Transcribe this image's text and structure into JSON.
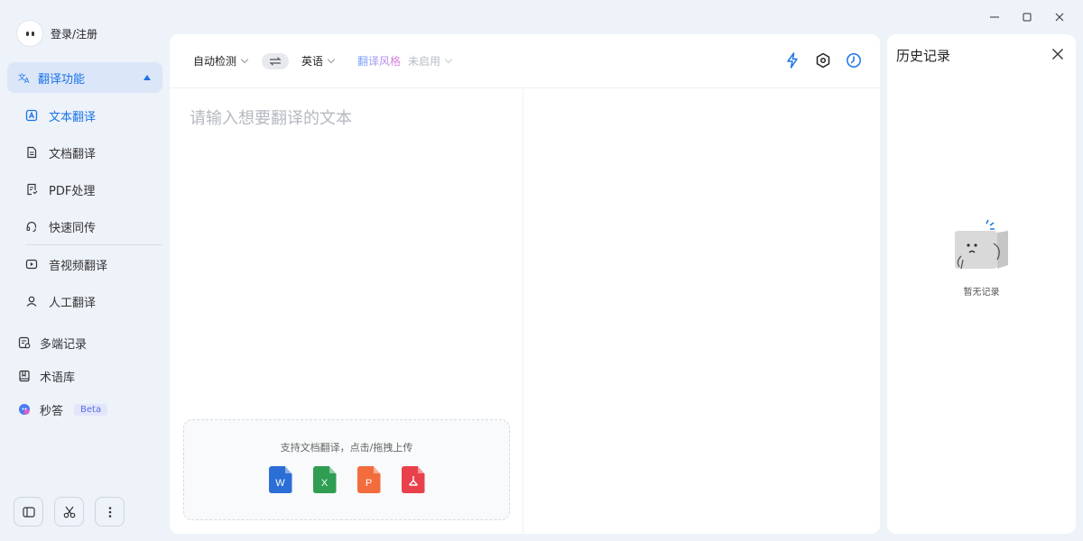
{
  "user": {
    "label": "登录/注册"
  },
  "nav": {
    "group_label": "翻译功能",
    "sub_items": [
      {
        "label": "文本翻译",
        "icon": "text-translate-icon",
        "active": true
      },
      {
        "label": "文档翻译",
        "icon": "document-icon",
        "active": false
      },
      {
        "label": "PDF处理",
        "icon": "pdf-icon",
        "active": false
      },
      {
        "label": "快速同传",
        "icon": "headset-icon",
        "active": false
      },
      {
        "label": "音视频翻译",
        "icon": "video-icon",
        "active": false
      },
      {
        "label": "人工翻译",
        "icon": "person-icon",
        "active": false
      }
    ],
    "top_items": [
      {
        "label": "多端记录",
        "icon": "records-icon"
      },
      {
        "label": "术语库",
        "icon": "book-icon"
      },
      {
        "label": "秒答",
        "icon": "ai-icon",
        "badge": "Beta"
      }
    ]
  },
  "toolbar": {
    "source_lang": "自动检测",
    "target_lang": "英语",
    "style_label": "翻译风格",
    "style_value": "未启用"
  },
  "source": {
    "placeholder": "请输入想要翻译的文本",
    "upload_hint": "支持文档翻译，点击/拖拽上传",
    "file_types": [
      {
        "letter": "W",
        "color": "#2b6fd6",
        "name": "word-file-icon"
      },
      {
        "letter": "X",
        "color": "#2f9e52",
        "name": "excel-file-icon"
      },
      {
        "letter": "P",
        "color": "#f26c3d",
        "name": "ppt-file-icon"
      },
      {
        "letter": "A",
        "color": "#e8414b",
        "name": "pdf-file-icon"
      }
    ]
  },
  "history": {
    "title": "历史记录",
    "empty": "暂无记录"
  },
  "colors": {
    "accent": "#1a73e8",
    "sidebar_bg": "#eef2f9",
    "active_bg": "#dbe6f8"
  }
}
